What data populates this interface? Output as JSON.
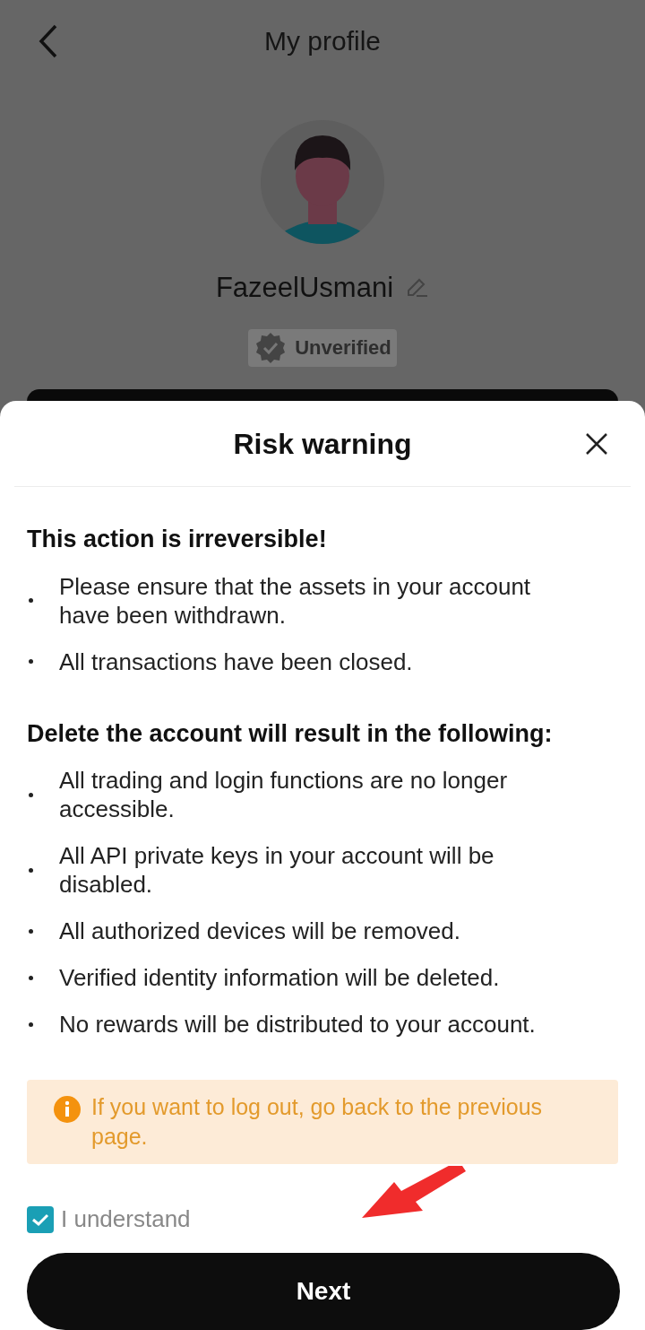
{
  "header": {
    "title": "My profile"
  },
  "profile": {
    "name": "FazeelUsmani",
    "badge": "Unverified"
  },
  "sheet": {
    "title": "Risk warning",
    "sections": [
      {
        "heading": "This action is irreversible!",
        "items": [
          "Please ensure that the assets in your account have been withdrawn.",
          "All transactions have been closed."
        ]
      },
      {
        "heading": "Delete the account will result in the following:",
        "items": [
          "All trading and login functions are no longer accessible.",
          "All API private keys in your account will be disabled.",
          "All authorized devices will be removed.",
          "Verified identity information will be deleted.",
          "No rewards will be distributed to your account."
        ]
      }
    ],
    "notice": "If you want to log out, go back to the previous page.",
    "agreement": {
      "label": "I understand",
      "checked": true
    },
    "button": "Next"
  }
}
